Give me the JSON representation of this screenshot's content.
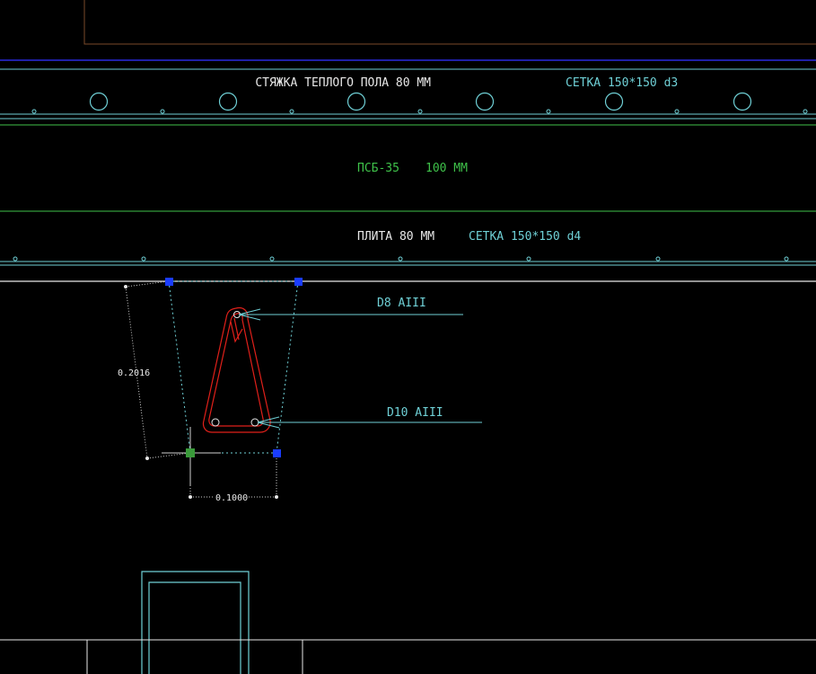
{
  "labels": {
    "screed": "СТЯЖКА ТЕПЛОГО ПОЛА 80 ММ",
    "screed_mesh": "СЕТКА 150*150 d3",
    "insulation": "ПСБ-35",
    "insulation_thickness": "100 ММ",
    "slab": "ПЛИТА 80 ММ",
    "slab_mesh": "СЕТКА 150*150 d4",
    "rebar_top": "D8 AIII",
    "rebar_bottom": "D10 AIII"
  },
  "dimensions": {
    "height": "0.2016",
    "width": "0.1000"
  },
  "colors": {
    "background": "#000000",
    "cyan": "#6fd0d6",
    "green": "#3fc24a",
    "white": "#e8e8e8",
    "red": "#e0201a",
    "grip_blue": "#1a3cff",
    "grip_green": "#3a9a3a",
    "brown": "#7a4a2a",
    "blue_line": "#2a2ae0"
  }
}
